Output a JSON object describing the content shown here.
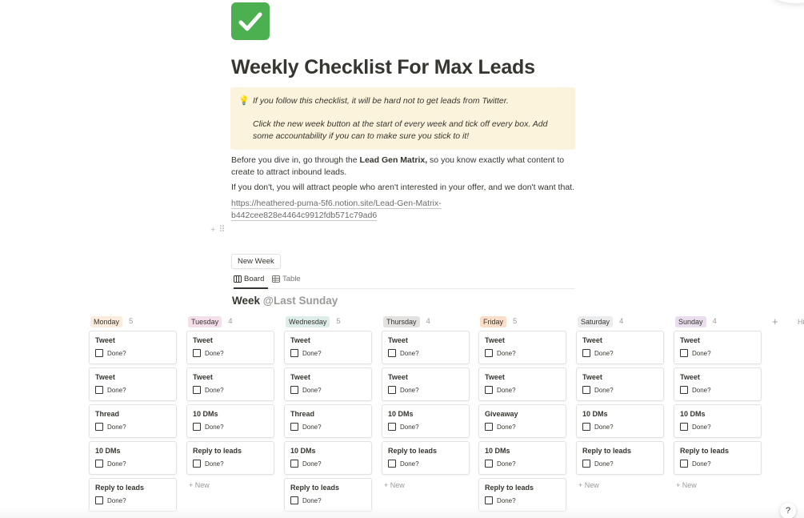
{
  "page": {
    "icon": "check-mark-button-emoji",
    "title": "Weekly Checklist For Max Leads"
  },
  "callout": {
    "icon": "light-bulb-emoji",
    "line1": "If you follow this checklist, it will be hard not to get leads from Twitter.",
    "line2": "Click the new week button at the start of every week and tick off every box. Add some accountability if you can to make sure you stick to it!"
  },
  "body": {
    "p1_before": "Before you dive in, go through the ",
    "p1_bold": "Lead Gen Matrix,",
    "p1_after": " so you know exactly what content to create to attract inbound leads.",
    "p2": "If you don't, you will attract people who aren't interested in your offer, and we don't want that.",
    "link_line1": "https://heathered-puma-5f6.notion.site/Lead-Gen-Matrix-",
    "link_line2": "b442cee828e4464c9912fdb571c79ad6"
  },
  "new_week_label": "New Week",
  "views": {
    "board": "Board",
    "table": "Table"
  },
  "database": {
    "title": "Week",
    "mention": "@Last Sunday"
  },
  "board": {
    "checkbox_label": "Done?",
    "new_label": "+ New",
    "add_column": "+",
    "hidden_label": "Hi",
    "columns": [
      {
        "name": "Monday",
        "count": "5",
        "color": "#fbecdd",
        "cards": [
          "Tweet",
          "Tweet",
          "Thread",
          "10 DMs",
          "Reply to leads"
        ]
      },
      {
        "name": "Tuesday",
        "count": "4",
        "color": "#f4dfeb",
        "cards": [
          "Tweet",
          "Tweet",
          "10 DMs",
          "Reply to leads"
        ]
      },
      {
        "name": "Wednesday",
        "count": "5",
        "color": "#ddedea",
        "cards": [
          "Tweet",
          "Tweet",
          "Thread",
          "10 DMs",
          "Reply to leads"
        ]
      },
      {
        "name": "Thursday",
        "count": "4",
        "color": "#e3e2e0",
        "cards": [
          "Tweet",
          "Tweet",
          "10 DMs",
          "Reply to leads"
        ]
      },
      {
        "name": "Friday",
        "count": "5",
        "color": "#fadec9",
        "cards": [
          "Tweet",
          "Tweet",
          "Giveaway",
          "10 DMs",
          "Reply to leads"
        ]
      },
      {
        "name": "Saturday",
        "count": "4",
        "color": "#ebeced",
        "cards": [
          "Tweet",
          "Tweet",
          "10 DMs",
          "Reply to leads"
        ]
      },
      {
        "name": "Sunday",
        "count": "4",
        "color": "#e8deee",
        "cards": [
          "Tweet",
          "Tweet",
          "10 DMs",
          "Reply to leads"
        ]
      }
    ]
  },
  "help_label": "?"
}
